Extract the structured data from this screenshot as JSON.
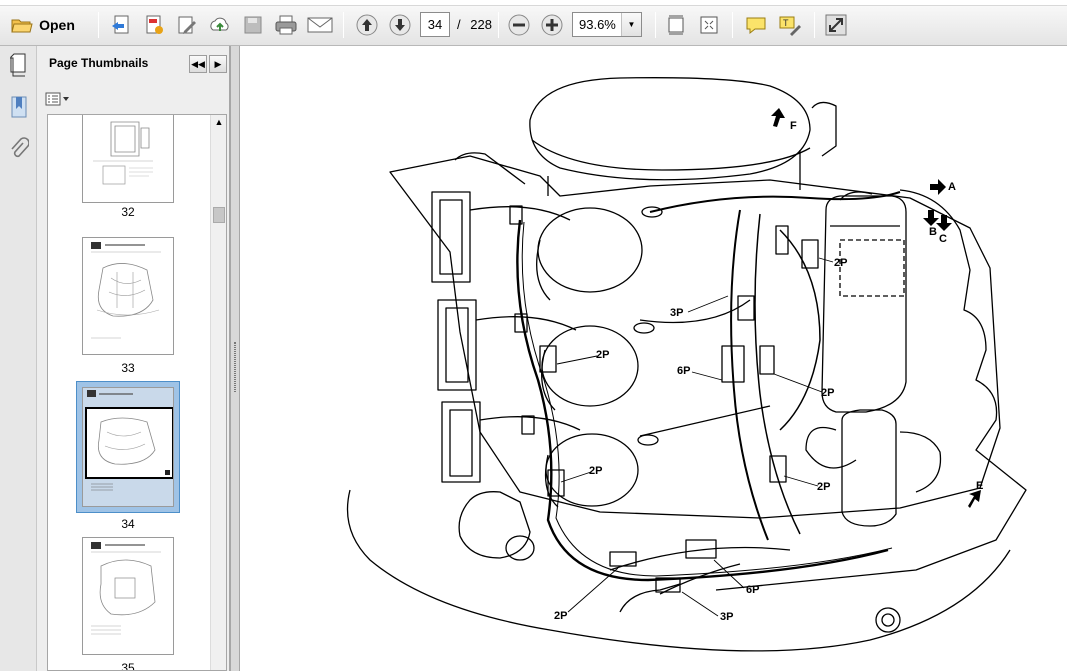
{
  "toolbar": {
    "open_label": "Open",
    "current_page": "34",
    "page_separator": "/",
    "total_pages": "228",
    "zoom": "93.6%",
    "icons": [
      "open-folder-icon",
      "create-pdf-icon",
      "export-icon",
      "edit-icon",
      "upload-icon",
      "save-icon",
      "print-icon",
      "email-icon",
      "previous-page-icon",
      "next-page-icon",
      "zoom-out-icon",
      "zoom-in-icon",
      "fit-width-icon",
      "fit-page-icon",
      "comment-icon",
      "highlight-icon",
      "expand-icon"
    ]
  },
  "sidebar": {
    "title": "Page Thumbnails",
    "thumbnails": [
      {
        "label": "32"
      },
      {
        "label": "33"
      },
      {
        "label": "34",
        "selected": true
      },
      {
        "label": "35"
      }
    ]
  },
  "diagram": {
    "callouts": {
      "a": "A",
      "b": "B",
      "c": "C",
      "e": "E",
      "f": "F",
      "p2_1": "2P",
      "p3_1": "3P",
      "p2_2": "2P",
      "p6_1": "6P",
      "p2_3": "2P",
      "p2_4": "2P",
      "p2_5": "2P",
      "p2_6": "2P",
      "p6_2": "6P",
      "p3_2": "3P"
    }
  },
  "colors": {
    "toolbar_bg": "#e9e9e9",
    "selected_thumb": "#9fc3e6",
    "panel_bg": "#eeeeee"
  }
}
